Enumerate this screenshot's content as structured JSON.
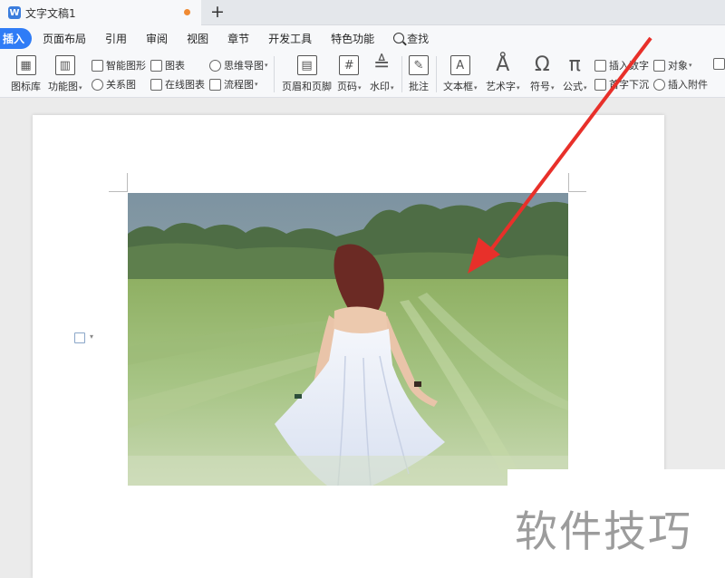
{
  "titlebar": {
    "app_icon_letter": "W",
    "doc_title": "文字文稿1",
    "new_tab": "+"
  },
  "menu": {
    "items": [
      "插入",
      "页面布局",
      "引用",
      "审阅",
      "视图",
      "章节",
      "开发工具",
      "特色功能"
    ],
    "active": "插入",
    "search": "查找"
  },
  "ribbon": {
    "icon_library": "图标库",
    "function_chart": "功能图",
    "smart_shape": "智能图形",
    "relation_chart": "关系图",
    "chart": "图表",
    "online_chart": "在线图表",
    "mind_map": "思维导图",
    "flowchart": "流程图",
    "header_footer": "页眉和页脚",
    "page_number": "页码",
    "watermark": "水印",
    "comment": "批注",
    "text_box": "文本框",
    "art_text": "艺术字",
    "symbol": "符号",
    "formula": "公式",
    "insert_number": "插入数字",
    "drop_cap": "首字下沉",
    "object": "对象",
    "insert_attachment": "插入附件"
  },
  "watermark_text": "软件技巧",
  "colors": {
    "accent": "#2f7cf6",
    "arrow": "#e8302a",
    "tab_dot": "#f08a32"
  }
}
